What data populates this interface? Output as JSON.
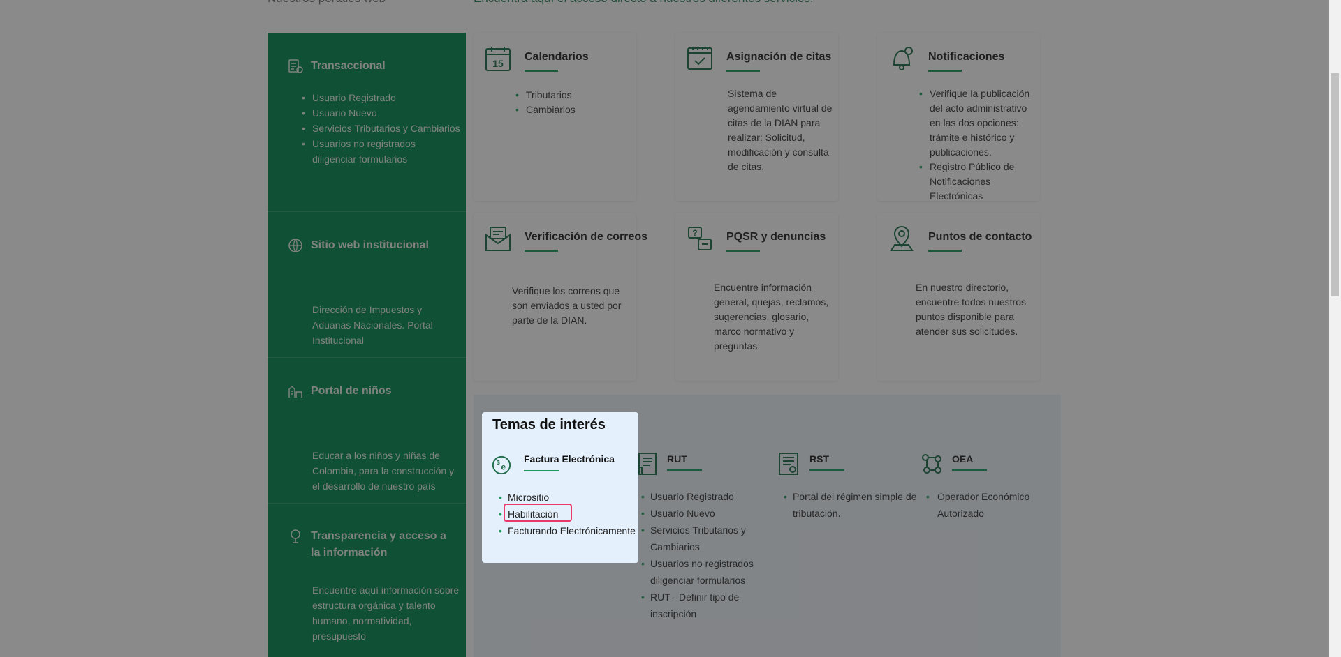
{
  "top": {
    "left_text": "Nuestros portales web",
    "right_text": "Encuentra aquí el acceso directo a nuestros diferentes servicios."
  },
  "left_sections": [
    {
      "title": "Transaccional",
      "icon": "transaction-icon",
      "items": [
        "Usuario Registrado",
        "Usuario Nuevo",
        "Servicios Tributarios y Cambiarios",
        "Usuarios no registrados diligenciar formularios"
      ]
    },
    {
      "title": "Sitio web institucional",
      "icon": "globe-icon",
      "description": "Dirección de Impuestos y Aduanas Nacionales. Portal Institucional"
    },
    {
      "title": "Portal de niños",
      "icon": "kids-icon",
      "description": "Educar a los niños y niñas de Colombia, para la construcción y el desarrollo de nuestro país"
    },
    {
      "title": "Transparencia y acceso a la información",
      "icon": "transparency-icon",
      "description": "Encuentre aquí información sobre estructura orgánica y talento humano, normatividad, presupuesto"
    }
  ],
  "cards": [
    {
      "title": "Calendarios",
      "icon": "calendar-icon",
      "items": [
        "Tributarios",
        "Cambiarios"
      ]
    },
    {
      "title": "Asignación de citas",
      "icon": "appointment-icon",
      "description": "Sistema de agendamiento virtual de citas de la DIAN para realizar: Solicitud, modificación y consulta de citas."
    },
    {
      "title": "Notificaciones",
      "icon": "notification-icon",
      "items": [
        "Verifique la publicación del acto administrativo en las dos opciones: trámite e histórico y publicaciones.",
        "Registro Público de Notificaciones Electrónicas"
      ]
    },
    {
      "title": "Verificación de correos",
      "icon": "mail-check-icon",
      "description": "Verifique los correos que son enviados a usted por parte de la DIAN."
    },
    {
      "title": "PQSR y denuncias",
      "icon": "complaint-icon",
      "description": "Encuentre información general, quejas, reclamos, sugerencias, glosario, marco normativo y preguntas."
    },
    {
      "title": "Puntos de contacto",
      "icon": "location-icon",
      "description": "En nuestro directorio, encuentre todos nuestros puntos disponible para atender sus solicitudes."
    }
  ],
  "temas": {
    "title": "Temas de interés",
    "topics": [
      {
        "title": "Factura Electrónica",
        "icon": "e-invoice-icon",
        "items": [
          "Micrositio",
          "Habilitación",
          "Facturando Electrónicamente"
        ]
      },
      {
        "title": "RUT",
        "icon": "rut-document-icon",
        "items": [
          "Usuario Registrado",
          "Usuario Nuevo",
          "Servicios Tributarios y Cambiarios",
          "Usuarios no registrados diligenciar formularios",
          "RUT - Definir tipo de inscripción"
        ]
      },
      {
        "title": "RST",
        "icon": "rst-document-icon",
        "items": [
          "Portal del régimen simple de tributación."
        ]
      },
      {
        "title": "OEA",
        "icon": "oea-network-icon",
        "items": [
          "Operador Económico Autorizado"
        ]
      }
    ]
  },
  "colors": {
    "brand_green": "#00874b",
    "accent_line": "#1d9a5b",
    "highlight_border": "#e8396a",
    "temas_bg": "#eef4fb"
  }
}
